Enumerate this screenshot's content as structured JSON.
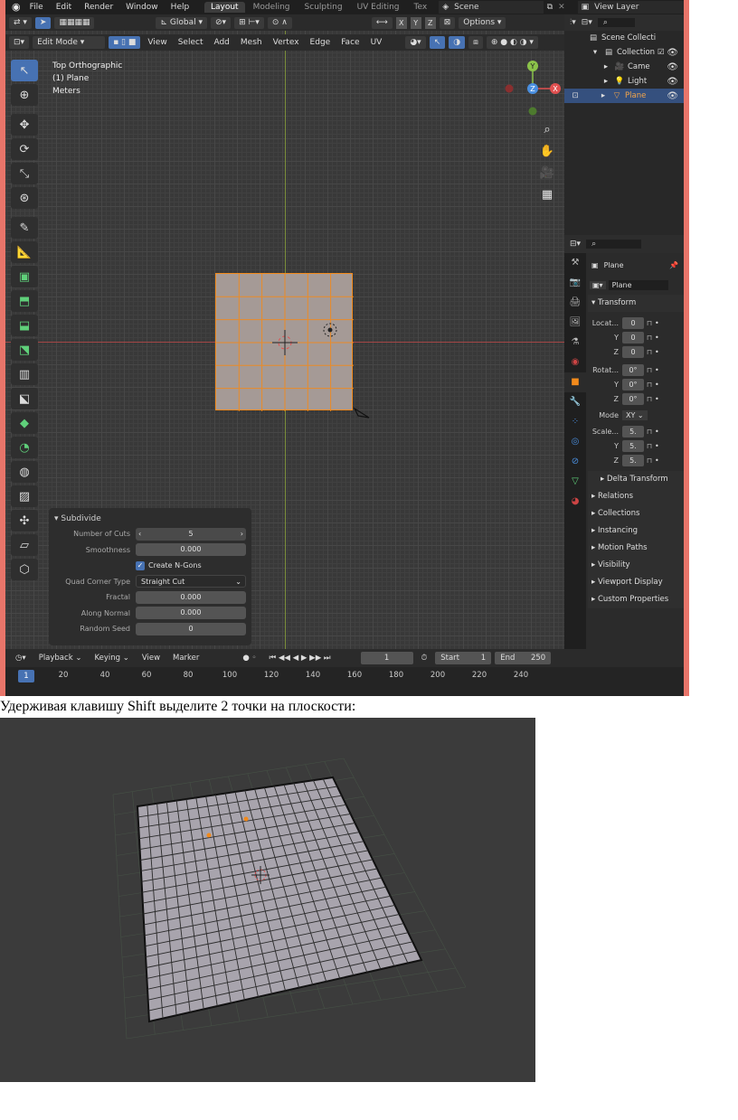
{
  "menu": {
    "items": [
      "File",
      "Edit",
      "Render",
      "Window",
      "Help"
    ],
    "workspaces": [
      "Layout",
      "Modeling",
      "Sculpting",
      "UV Editing",
      "Tex"
    ],
    "scene": "Scene",
    "view_layer": "View Layer"
  },
  "toolheader": {
    "orientation": "Global",
    "xyz": [
      "X",
      "Y",
      "Z"
    ],
    "options": "Options"
  },
  "viewport_header": {
    "mode": "Edit Mode",
    "menus": [
      "View",
      "Select",
      "Add",
      "Mesh",
      "Vertex",
      "Edge",
      "Face",
      "UV"
    ]
  },
  "viewport_info": {
    "view": "Top Orthographic",
    "object": "(1) Plane",
    "units": "Meters"
  },
  "gizmo": {
    "y": "Y",
    "z": "Z",
    "x": "X"
  },
  "operator_panel": {
    "title": "Subdivide",
    "number_of_cuts_label": "Number of Cuts",
    "number_of_cuts": "5",
    "smoothness_label": "Smoothness",
    "smoothness": "0.000",
    "create_ngons": "Create N-Gons",
    "quad_corner_label": "Quad Corner Type",
    "quad_corner": "Straight Cut",
    "fractal_label": "Fractal",
    "fractal": "0.000",
    "along_normal_label": "Along Normal",
    "along_normal": "0.000",
    "random_seed_label": "Random Seed",
    "random_seed": "0"
  },
  "outliner": {
    "scene_collection": "Scene Collecti",
    "collection": "Collection",
    "camera": "Came",
    "light": "Light",
    "plane": "Plane"
  },
  "properties": {
    "object_name": "Plane",
    "mesh_name": "Plane",
    "transform": "Transform",
    "location_label": "Locat...",
    "location": [
      "0",
      "0",
      "0"
    ],
    "rotation_label": "Rotat...",
    "rotation": [
      "0°",
      "0°",
      "0°"
    ],
    "mode_label": "Mode",
    "mode": "XY",
    "scale_label": "Scale...",
    "scale": [
      "5.",
      "5.",
      "5."
    ],
    "axis_y": "Y",
    "axis_z": "Z",
    "delta_transform": "Delta Transform",
    "sections": [
      "Relations",
      "Collections",
      "Instancing",
      "Motion Paths",
      "Visibility",
      "Viewport Display",
      "Custom Properties"
    ]
  },
  "timeline": {
    "playback": "Playback",
    "keying": "Keying",
    "view": "View",
    "marker": "Marker",
    "current_frame": "1",
    "start_label": "Start",
    "start": "1",
    "end_label": "End",
    "end": "250",
    "ticks": [
      "20",
      "40",
      "60",
      "80",
      "100",
      "120",
      "140",
      "160",
      "180",
      "200",
      "220",
      "240"
    ],
    "cursor": "1"
  },
  "caption": "Удерживая клавишу Shift выделите 2 точки на плоскости:"
}
